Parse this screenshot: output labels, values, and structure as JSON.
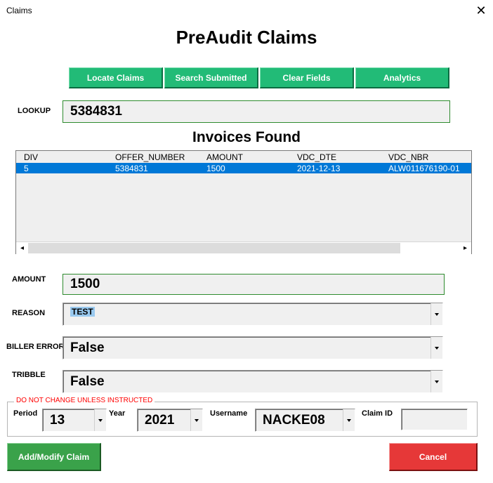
{
  "window": {
    "title": "Claims",
    "close_glyph": "✕"
  },
  "heading": "PreAudit Claims",
  "toolbar": {
    "locate": "Locate Claims",
    "search_submitted": "Search Submitted",
    "clear": "Clear Fields",
    "analytics": "Analytics"
  },
  "lookup": {
    "label": "LOOKUP",
    "value": "5384831"
  },
  "invoices": {
    "title": "Invoices Found",
    "columns": [
      "DIV",
      "OFFER_NUMBER",
      "AMOUNT",
      "VDC_DTE",
      "VDC_NBR"
    ],
    "rows": [
      [
        "5",
        "5384831",
        "1500",
        "2021-12-13",
        "ALW011676190-01"
      ]
    ],
    "scroll_left_glyph": "◂",
    "scroll_right_glyph": "▸"
  },
  "amount": {
    "label": "AMOUNT",
    "value": "1500"
  },
  "reason": {
    "label": "REASON",
    "value": "TEST"
  },
  "biller_error": {
    "label": "BILLER ERROR",
    "value": "False"
  },
  "tribble": {
    "label": "TRIBBLE",
    "value": "False"
  },
  "instructed": {
    "caption": "DO NOT CHANGE UNLESS INSTRUCTED",
    "period_label": "Period",
    "period_value": "13",
    "year_label": "Year",
    "year_value": "2021",
    "username_label": "Username",
    "username_value": "NACKE08",
    "claim_id_label": "Claim ID",
    "claim_id_value": ""
  },
  "actions": {
    "add_modify": "Add/Modify Claim",
    "cancel": "Cancel"
  },
  "colors": {
    "toolbar_green": "#22bb77",
    "add_green": "#3aa24a",
    "cancel_red": "#e63838",
    "selection_blue": "#0078d7",
    "field_border_green": "#2e8b2e",
    "caption_red": "#ff0000"
  },
  "icons": {
    "close": "close-icon",
    "scroll_left": "scroll-left-icon",
    "scroll_right": "scroll-right-icon",
    "dropdown": "chevron-down-icon"
  }
}
